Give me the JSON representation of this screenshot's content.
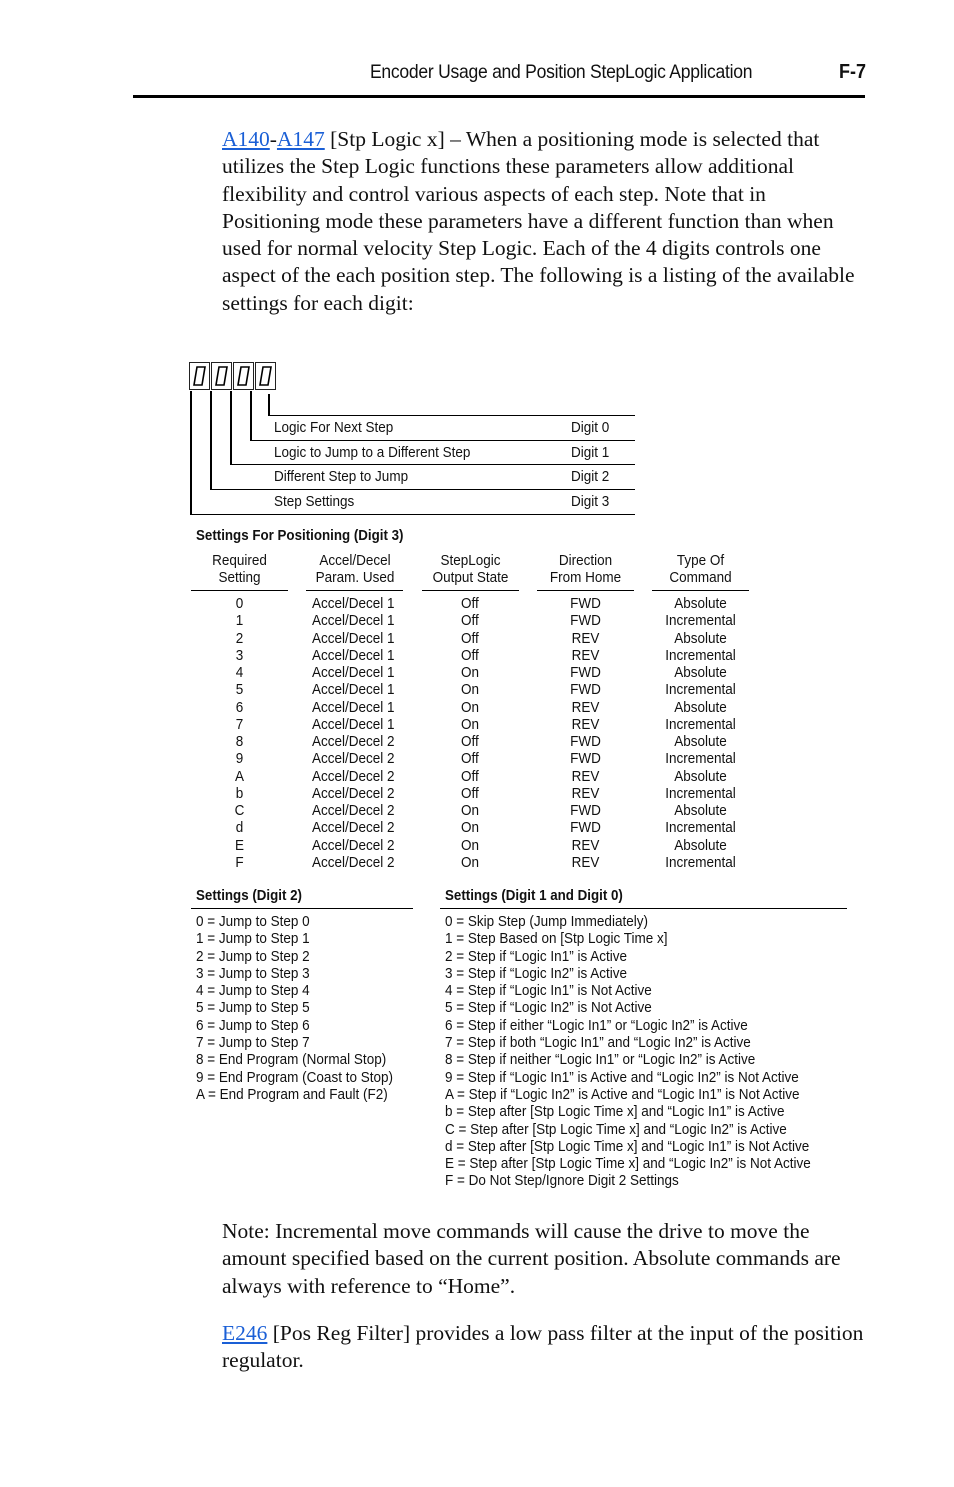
{
  "header": {
    "running_title": "Encoder Usage and Position StepLogic Application",
    "page_number": "F-7"
  },
  "intro": {
    "link1": "A140",
    "dash": "-",
    "link2": "A147",
    "text": " [Stp Logic x] – When a positioning mode is selected that utilizes the Step Logic functions these parameters allow additional flexibility and control various aspects of each step. Note that in Positioning mode these parameters have a different function than when used for normal velocity Step Logic. Each of the 4 digits controls one aspect of the each position step. The following is a listing of the available settings for each digit:"
  },
  "digit_diagram": {
    "display_value": "0000",
    "rows": [
      {
        "label": "Logic For Next Step",
        "digit": "Digit 0"
      },
      {
        "label": "Logic to Jump to a Different Step",
        "digit": "Digit 1"
      },
      {
        "label": "Different Step to Jump",
        "digit": "Digit 2"
      },
      {
        "label": "Step Settings",
        "digit": "Digit 3"
      }
    ]
  },
  "positioning_table": {
    "title": "Settings For Positioning (Digit 3)",
    "headers": [
      [
        "Required",
        "Setting"
      ],
      [
        "Accel/Decel",
        "Param. Used"
      ],
      [
        "StepLogic",
        "Output State"
      ],
      [
        "Direction",
        "From Home"
      ],
      [
        "Type Of",
        "Command"
      ]
    ],
    "rows": [
      [
        "0",
        "Accel/Decel 1",
        "Off",
        "FWD",
        "Absolute"
      ],
      [
        "1",
        "Accel/Decel 1",
        "Off",
        "FWD",
        "Incremental"
      ],
      [
        "2",
        "Accel/Decel 1",
        "Off",
        "REV",
        "Absolute"
      ],
      [
        "3",
        "Accel/Decel 1",
        "Off",
        "REV",
        "Incremental"
      ],
      [
        "4",
        "Accel/Decel 1",
        "On",
        "FWD",
        "Absolute"
      ],
      [
        "5",
        "Accel/Decel 1",
        "On",
        "FWD",
        "Incremental"
      ],
      [
        "6",
        "Accel/Decel 1",
        "On",
        "REV",
        "Absolute"
      ],
      [
        "7",
        "Accel/Decel 1",
        "On",
        "REV",
        "Incremental"
      ],
      [
        "8",
        "Accel/Decel 2",
        "Off",
        "FWD",
        "Absolute"
      ],
      [
        "9",
        "Accel/Decel 2",
        "Off",
        "FWD",
        "Incremental"
      ],
      [
        "A",
        "Accel/Decel 2",
        "Off",
        "REV",
        "Absolute"
      ],
      [
        "b",
        "Accel/Decel 2",
        "Off",
        "REV",
        "Incremental"
      ],
      [
        "C",
        "Accel/Decel 2",
        "On",
        "FWD",
        "Absolute"
      ],
      [
        "d",
        "Accel/Decel 2",
        "On",
        "FWD",
        "Incremental"
      ],
      [
        "E",
        "Accel/Decel 2",
        "On",
        "REV",
        "Absolute"
      ],
      [
        "F",
        "Accel/Decel 2",
        "On",
        "REV",
        "Incremental"
      ]
    ]
  },
  "digit2_settings": {
    "title": "Settings (Digit 2)",
    "items": [
      "0 = Jump to Step 0",
      "1 = Jump to Step 1",
      "2 = Jump to Step 2",
      "3 = Jump to Step 3",
      "4 = Jump to Step 4",
      "5 = Jump to Step 5",
      "6 = Jump to Step 6",
      "7 = Jump to Step 7",
      "8 = End Program (Normal Stop)",
      "9 = End Program (Coast to Stop)",
      "A = End Program and Fault (F2)"
    ]
  },
  "digit10_settings": {
    "title": "Settings (Digit 1 and Digit 0)",
    "items": [
      "0 = Skip Step (Jump Immediately)",
      "1 = Step Based on [Stp Logic Time x]",
      "2 = Step if “Logic In1” is Active",
      "3 = Step if “Logic In2” is Active",
      "4 = Step if “Logic In1” is Not Active",
      "5 = Step if “Logic In2” is Not Active",
      "6 = Step if either “Logic In1” or “Logic In2” is Active",
      "7 = Step if both “Logic In1” and “Logic In2” is Active",
      "8 = Step if neither “Logic In1” or “Logic In2” is Active",
      "9 = Step if “Logic In1” is Active and “Logic In2” is Not Active",
      "A = Step if “Logic In2” is Active and “Logic In1” is Not Active",
      "b = Step after [Stp Logic Time x] and “Logic In1” is Active",
      "C = Step after [Stp Logic Time x] and “Logic In2” is Active",
      "d = Step after [Stp Logic Time x] and “Logic In1” is Not Active",
      "E = Step after [Stp Logic Time x] and “Logic In2” is Not Active",
      "F = Do Not Step/Ignore Digit 2 Settings"
    ]
  },
  "note": {
    "text": "Note: Incremental move commands will cause the drive to move the amount specified based on the current position. Absolute commands are always with reference to “Home”."
  },
  "e246": {
    "link": "E246",
    "text": " [Pos Reg Filter] provides a low pass filter at the input of the position regulator."
  },
  "colors": {
    "link": "#1a5fd6",
    "text": "#111111",
    "rule": "#000000"
  }
}
